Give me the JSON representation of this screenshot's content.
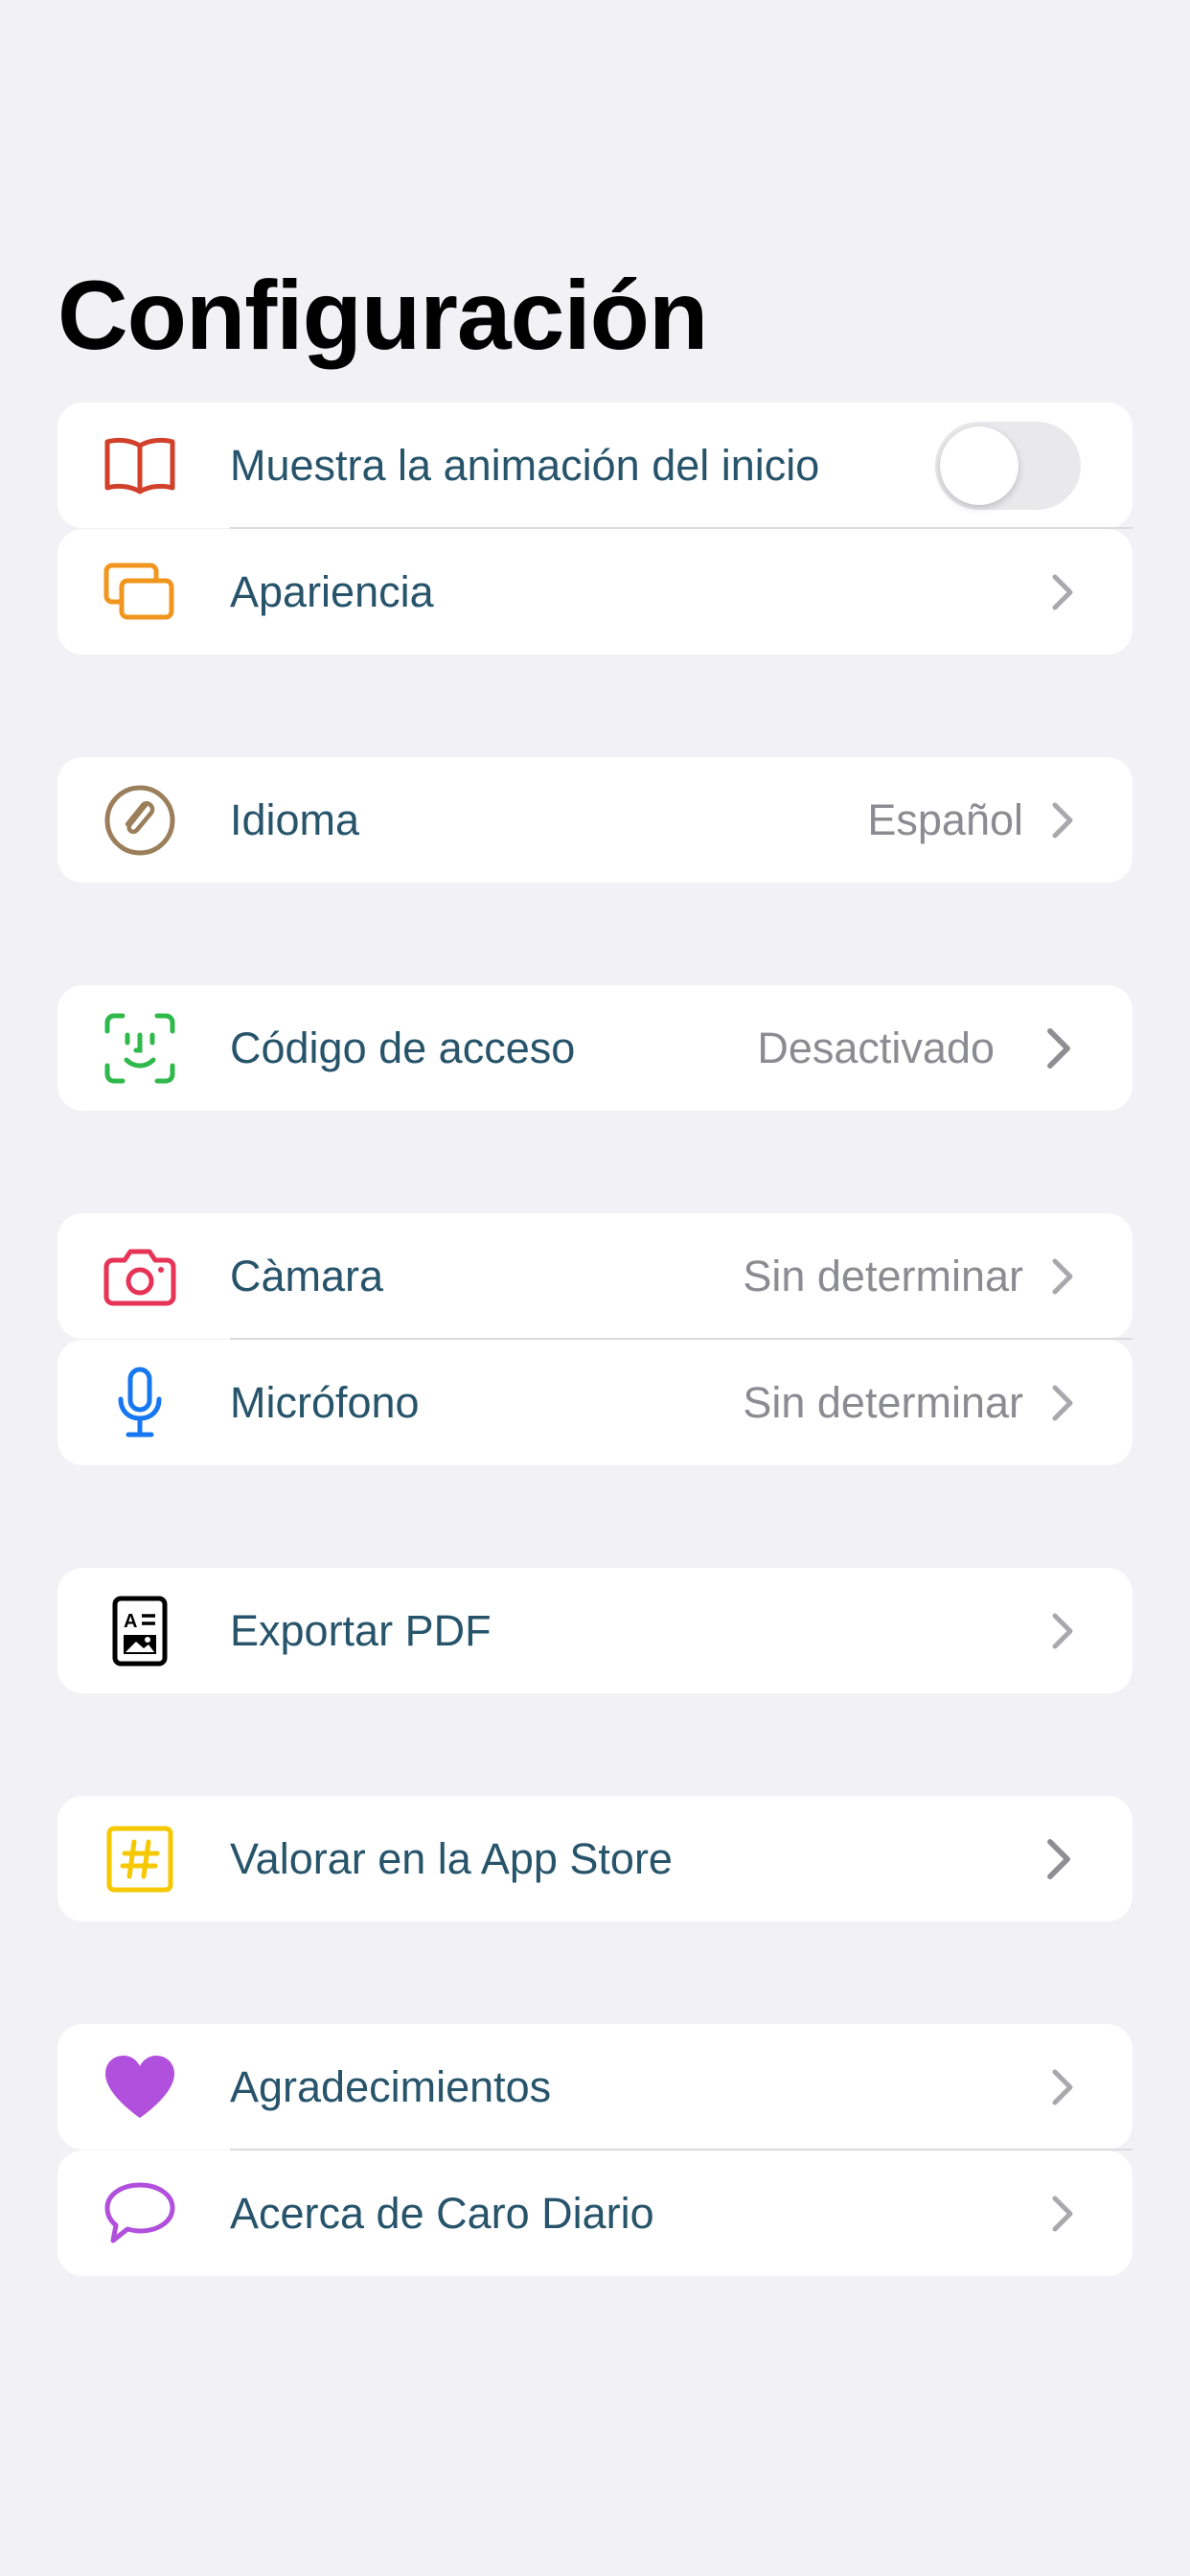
{
  "page": {
    "title": "Configuración"
  },
  "groups": {
    "general": {
      "startup_animation": {
        "label": "Muestra la animación del inicio",
        "icon": "book-icon",
        "toggle_on": false
      },
      "appearance": {
        "label": "Apariencia",
        "icon": "windows-icon"
      }
    },
    "language": {
      "label": "Idioma",
      "value": "Español",
      "icon": "paperclip-icon"
    },
    "passcode": {
      "label": "Código de acceso",
      "value": "Desactivado",
      "icon": "face-id-icon"
    },
    "permissions": {
      "camera": {
        "label": "Càmara",
        "value": "Sin determinar",
        "icon": "camera-icon"
      },
      "microphone": {
        "label": "Micrófono",
        "value": "Sin determinar",
        "icon": "microphone-icon"
      }
    },
    "export": {
      "label": "Exportar PDF",
      "icon": "document-icon"
    },
    "rate": {
      "label": "Valorar en la App Store",
      "icon": "hashtag-icon"
    },
    "about": {
      "acknowledgements": {
        "label": "Agradecimientos",
        "icon": "heart-icon"
      },
      "about_app": {
        "label": "Acerca de Caro Diario",
        "icon": "speech-bubble-icon"
      }
    }
  },
  "colors": {
    "background": "#f1f1f6",
    "label": "#27546b",
    "value": "#8b8b92",
    "book": "#d0402b",
    "appearance": "#f0961e",
    "paperclip": "#9b7e5a",
    "face_id": "#2fb84c",
    "camera": "#e63356",
    "microphone": "#1677f0",
    "hashtag": "#f5c800",
    "heart": "#b150dd"
  }
}
